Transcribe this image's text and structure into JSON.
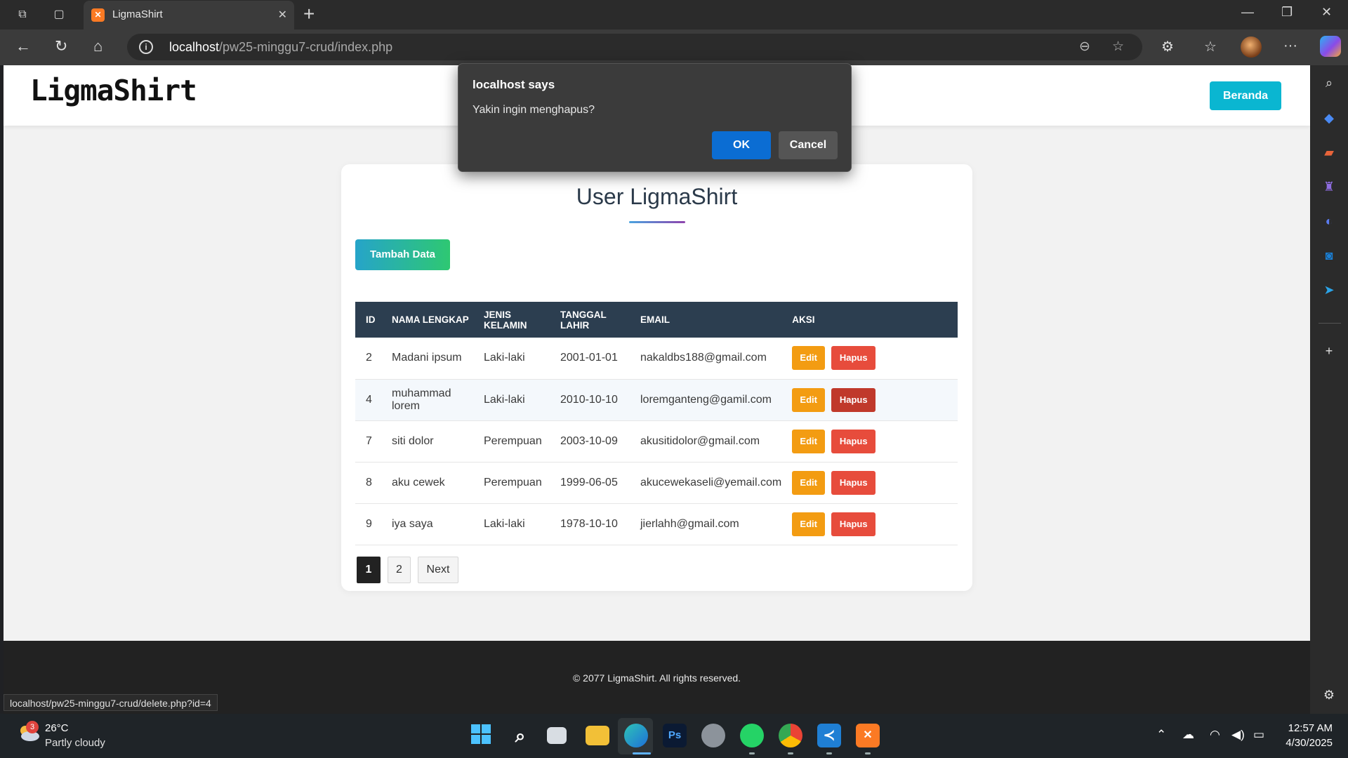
{
  "browser": {
    "tab_title": "LigmaShirt",
    "url_host": "localhost",
    "url_path": "/pw25-minggu7-crud/index.php",
    "status_url": "localhost/pw25-minggu7-crud/delete.php?id=4"
  },
  "site": {
    "logo": "LigmaShirt",
    "nav_button": "Beranda",
    "page_title": "User LigmaShirt",
    "add_button": "Tambah Data",
    "footer": "© 2077 LigmaShirt. All rights reserved."
  },
  "table": {
    "headers": [
      "ID",
      "NAMA LENGKAP",
      "JENIS KELAMIN",
      "TANGGAL LAHIR",
      "EMAIL",
      "AKSI"
    ],
    "rows": [
      {
        "id": "2",
        "name": "Madani ipsum",
        "gender": "Laki-laki",
        "dob": "2001-01-01",
        "email": "nakaldbs188@gmail.com"
      },
      {
        "id": "4",
        "name": "muhammad lorem",
        "gender": "Laki-laki",
        "dob": "2010-10-10",
        "email": "loremganteng@gamil.com"
      },
      {
        "id": "7",
        "name": "siti dolor",
        "gender": "Perempuan",
        "dob": "2003-10-09",
        "email": "akusitidolor@gmail.com"
      },
      {
        "id": "8",
        "name": "aku cewek",
        "gender": "Perempuan",
        "dob": "1999-06-05",
        "email": "akucewekaseli@yemail.com"
      },
      {
        "id": "9",
        "name": "iya saya",
        "gender": "Laki-laki",
        "dob": "1978-10-10",
        "email": "jierlahh@gmail.com"
      }
    ],
    "edit_label": "Edit",
    "delete_label": "Hapus"
  },
  "pagination": {
    "pages": [
      "1",
      "2"
    ],
    "current": "1",
    "next": "Next"
  },
  "dialog": {
    "title": "localhost says",
    "message": "Yakin ingin menghapus?",
    "ok": "OK",
    "cancel": "Cancel"
  },
  "taskbar": {
    "weather_temp": "26°C",
    "weather_desc": "Partly cloudy",
    "weather_badge": "3",
    "time": "12:57 AM",
    "date": "4/30/2025"
  },
  "colors": {
    "header_dark": "#2c3e50",
    "edit": "#f39c12",
    "delete": "#e74c3c",
    "accent_cyan": "#0ab6d1",
    "dialog_ok": "#0b6dd3"
  }
}
